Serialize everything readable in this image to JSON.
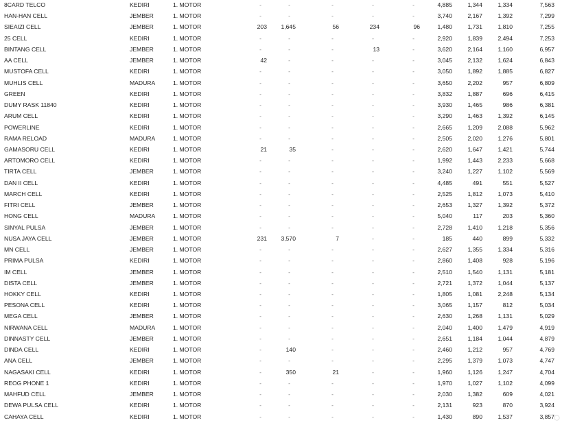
{
  "rows": [
    [
      "8CARD TELCO",
      "KEDIRI",
      "1. MOTOR",
      "-",
      "-",
      "-",
      "-",
      "-",
      "4,885",
      "1,344",
      "1,334",
      "7,563"
    ],
    [
      "HAN-HAN CELL",
      "JEMBER",
      "1. MOTOR",
      "-",
      "-",
      "-",
      "-",
      "-",
      "3,740",
      "2,167",
      "1,392",
      "7,299"
    ],
    [
      "SIEAIZI CELL",
      "JEMBER",
      "1. MOTOR",
      "203",
      "1,645",
      "56",
      "234",
      "96",
      "1,480",
      "1,731",
      "1,810",
      "7,255"
    ],
    [
      "25 CELL",
      "KEDIRI",
      "1. MOTOR",
      "-",
      "-",
      "-",
      "-",
      "-",
      "2,920",
      "1,839",
      "2,494",
      "7,253"
    ],
    [
      "BINTANG CELL",
      "JEMBER",
      "1. MOTOR",
      "-",
      "-",
      "-",
      "13",
      "-",
      "3,620",
      "2,164",
      "1,160",
      "6,957"
    ],
    [
      "AA CELL",
      "JEMBER",
      "1. MOTOR",
      "42",
      "-",
      "-",
      "-",
      "-",
      "3,045",
      "2,132",
      "1,624",
      "6,843"
    ],
    [
      "MUSTOFA CELL",
      "KEDIRI",
      "1. MOTOR",
      "-",
      "-",
      "-",
      "-",
      "-",
      "3,050",
      "1,892",
      "1,885",
      "6,827"
    ],
    [
      "MUHLIS CELL",
      "MADURA",
      "1. MOTOR",
      "-",
      "-",
      "-",
      "-",
      "-",
      "3,650",
      "2,202",
      "957",
      "6,809"
    ],
    [
      "GREEN",
      "KEDIRI",
      "1. MOTOR",
      "-",
      "-",
      "-",
      "-",
      "-",
      "3,832",
      "1,887",
      "696",
      "6,415"
    ],
    [
      "DUMY RASK 11840",
      "KEDIRI",
      "1. MOTOR",
      "-",
      "-",
      "-",
      "-",
      "-",
      "3,930",
      "1,465",
      "986",
      "6,381"
    ],
    [
      "ARUM CELL",
      "KEDIRI",
      "1. MOTOR",
      "-",
      "-",
      "-",
      "-",
      "-",
      "3,290",
      "1,463",
      "1,392",
      "6,145"
    ],
    [
      "POWERLINE",
      "KEDIRI",
      "1. MOTOR",
      "-",
      "-",
      "-",
      "-",
      "-",
      "2,665",
      "1,209",
      "2,088",
      "5,962"
    ],
    [
      "RAMA RELOAD",
      "MADURA",
      "1. MOTOR",
      "-",
      "-",
      "-",
      "-",
      "-",
      "2,505",
      "2,020",
      "1,276",
      "5,801"
    ],
    [
      "GAMASORU CELL",
      "KEDIRI",
      "1. MOTOR",
      "21",
      "35",
      "-",
      "-",
      "-",
      "2,620",
      "1,647",
      "1,421",
      "5,744"
    ],
    [
      "ARTOMORO CELL",
      "KEDIRI",
      "1. MOTOR",
      "-",
      "-",
      "-",
      "-",
      "-",
      "1,992",
      "1,443",
      "2,233",
      "5,668"
    ],
    [
      "TIRTA CELL",
      "JEMBER",
      "1. MOTOR",
      "-",
      "-",
      "-",
      "-",
      "-",
      "3,240",
      "1,227",
      "1,102",
      "5,569"
    ],
    [
      "DAN II CELL",
      "KEDIRI",
      "1. MOTOR",
      "-",
      "-",
      "-",
      "-",
      "-",
      "4,485",
      "491",
      "551",
      "5,527"
    ],
    [
      "MARCH CELL",
      "KEDIRI",
      "1. MOTOR",
      "-",
      "-",
      "-",
      "-",
      "-",
      "2,525",
      "1,812",
      "1,073",
      "5,410"
    ],
    [
      "FITRI CELL",
      "JEMBER",
      "1. MOTOR",
      "-",
      "-",
      "-",
      "-",
      "-",
      "2,653",
      "1,327",
      "1,392",
      "5,372"
    ],
    [
      "HONG CELL",
      "MADURA",
      "1. MOTOR",
      "-",
      "-",
      "-",
      "-",
      "-",
      "5,040",
      "117",
      "203",
      "5,360"
    ],
    [
      "SINYAL PULSA",
      "JEMBER",
      "1. MOTOR",
      "-",
      "-",
      "-",
      "-",
      "-",
      "2,728",
      "1,410",
      "1,218",
      "5,356"
    ],
    [
      "NUSA JAYA CELL",
      "JEMBER",
      "1. MOTOR",
      "231",
      "3,570",
      "7",
      "-",
      "-",
      "185",
      "440",
      "899",
      "5,332"
    ],
    [
      "MN CELL",
      "JEMBER",
      "1. MOTOR",
      "-",
      "-",
      "-",
      "-",
      "-",
      "2,627",
      "1,355",
      "1,334",
      "5,316"
    ],
    [
      "PRIMA PULSA",
      "KEDIRI",
      "1. MOTOR",
      "-",
      "-",
      "-",
      "-",
      "-",
      "2,860",
      "1,408",
      "928",
      "5,196"
    ],
    [
      "IM CELL",
      "JEMBER",
      "1. MOTOR",
      "-",
      "-",
      "-",
      "-",
      "-",
      "2,510",
      "1,540",
      "1,131",
      "5,181"
    ],
    [
      "DISTA CELL",
      "JEMBER",
      "1. MOTOR",
      "-",
      "-",
      "-",
      "-",
      "-",
      "2,721",
      "1,372",
      "1,044",
      "5,137"
    ],
    [
      "HOKKY CELL",
      "KEDIRI",
      "1. MOTOR",
      "-",
      "-",
      "-",
      "-",
      "-",
      "1,805",
      "1,081",
      "2,248",
      "5,134"
    ],
    [
      "PESONA CELL",
      "KEDIRI",
      "1. MOTOR",
      "-",
      "-",
      "-",
      "-",
      "-",
      "3,065",
      "1,157",
      "812",
      "5,034"
    ],
    [
      "MEGA CELL",
      "JEMBER",
      "1. MOTOR",
      "-",
      "-",
      "-",
      "-",
      "-",
      "2,630",
      "1,268",
      "1,131",
      "5,029"
    ],
    [
      "NIRWANA CELL",
      "MADURA",
      "1. MOTOR",
      "-",
      "-",
      "-",
      "-",
      "-",
      "2,040",
      "1,400",
      "1,479",
      "4,919"
    ],
    [
      "DINNASTY CELL",
      "JEMBER",
      "1. MOTOR",
      "-",
      "-",
      "-",
      "-",
      "-",
      "2,651",
      "1,184",
      "1,044",
      "4,879"
    ],
    [
      "DINDA CELL",
      "KEDIRI",
      "1. MOTOR",
      "-",
      "140",
      "-",
      "-",
      "-",
      "2,460",
      "1,212",
      "957",
      "4,769"
    ],
    [
      "ANA CELL",
      "JEMBER",
      "1. MOTOR",
      "-",
      "-",
      "-",
      "-",
      "-",
      "2,295",
      "1,379",
      "1,073",
      "4,747"
    ],
    [
      "NAGASAKI CELL",
      "KEDIRI",
      "1. MOTOR",
      "-",
      "350",
      "21",
      "-",
      "-",
      "1,960",
      "1,126",
      "1,247",
      "4,704"
    ],
    [
      "REOG PHONE 1",
      "KEDIRI",
      "1. MOTOR",
      "-",
      "-",
      "-",
      "-",
      "-",
      "1,970",
      "1,027",
      "1,102",
      "4,099"
    ],
    [
      "MAHFUD CELL",
      "JEMBER",
      "1. MOTOR",
      "-",
      "-",
      "-",
      "-",
      "-",
      "2,030",
      "1,382",
      "609",
      "4,021"
    ],
    [
      "DEWA PULSA CELL",
      "KEDIRI",
      "1. MOTOR",
      "-",
      "-",
      "-",
      "-",
      "-",
      "2,131",
      "923",
      "870",
      "3,924"
    ],
    [
      "CAHAYA CELL",
      "KEDIRI",
      "1. MOTOR",
      "-",
      "-",
      "-",
      "-",
      "-",
      "1,430",
      "890",
      "1,537",
      "3,857"
    ]
  ]
}
